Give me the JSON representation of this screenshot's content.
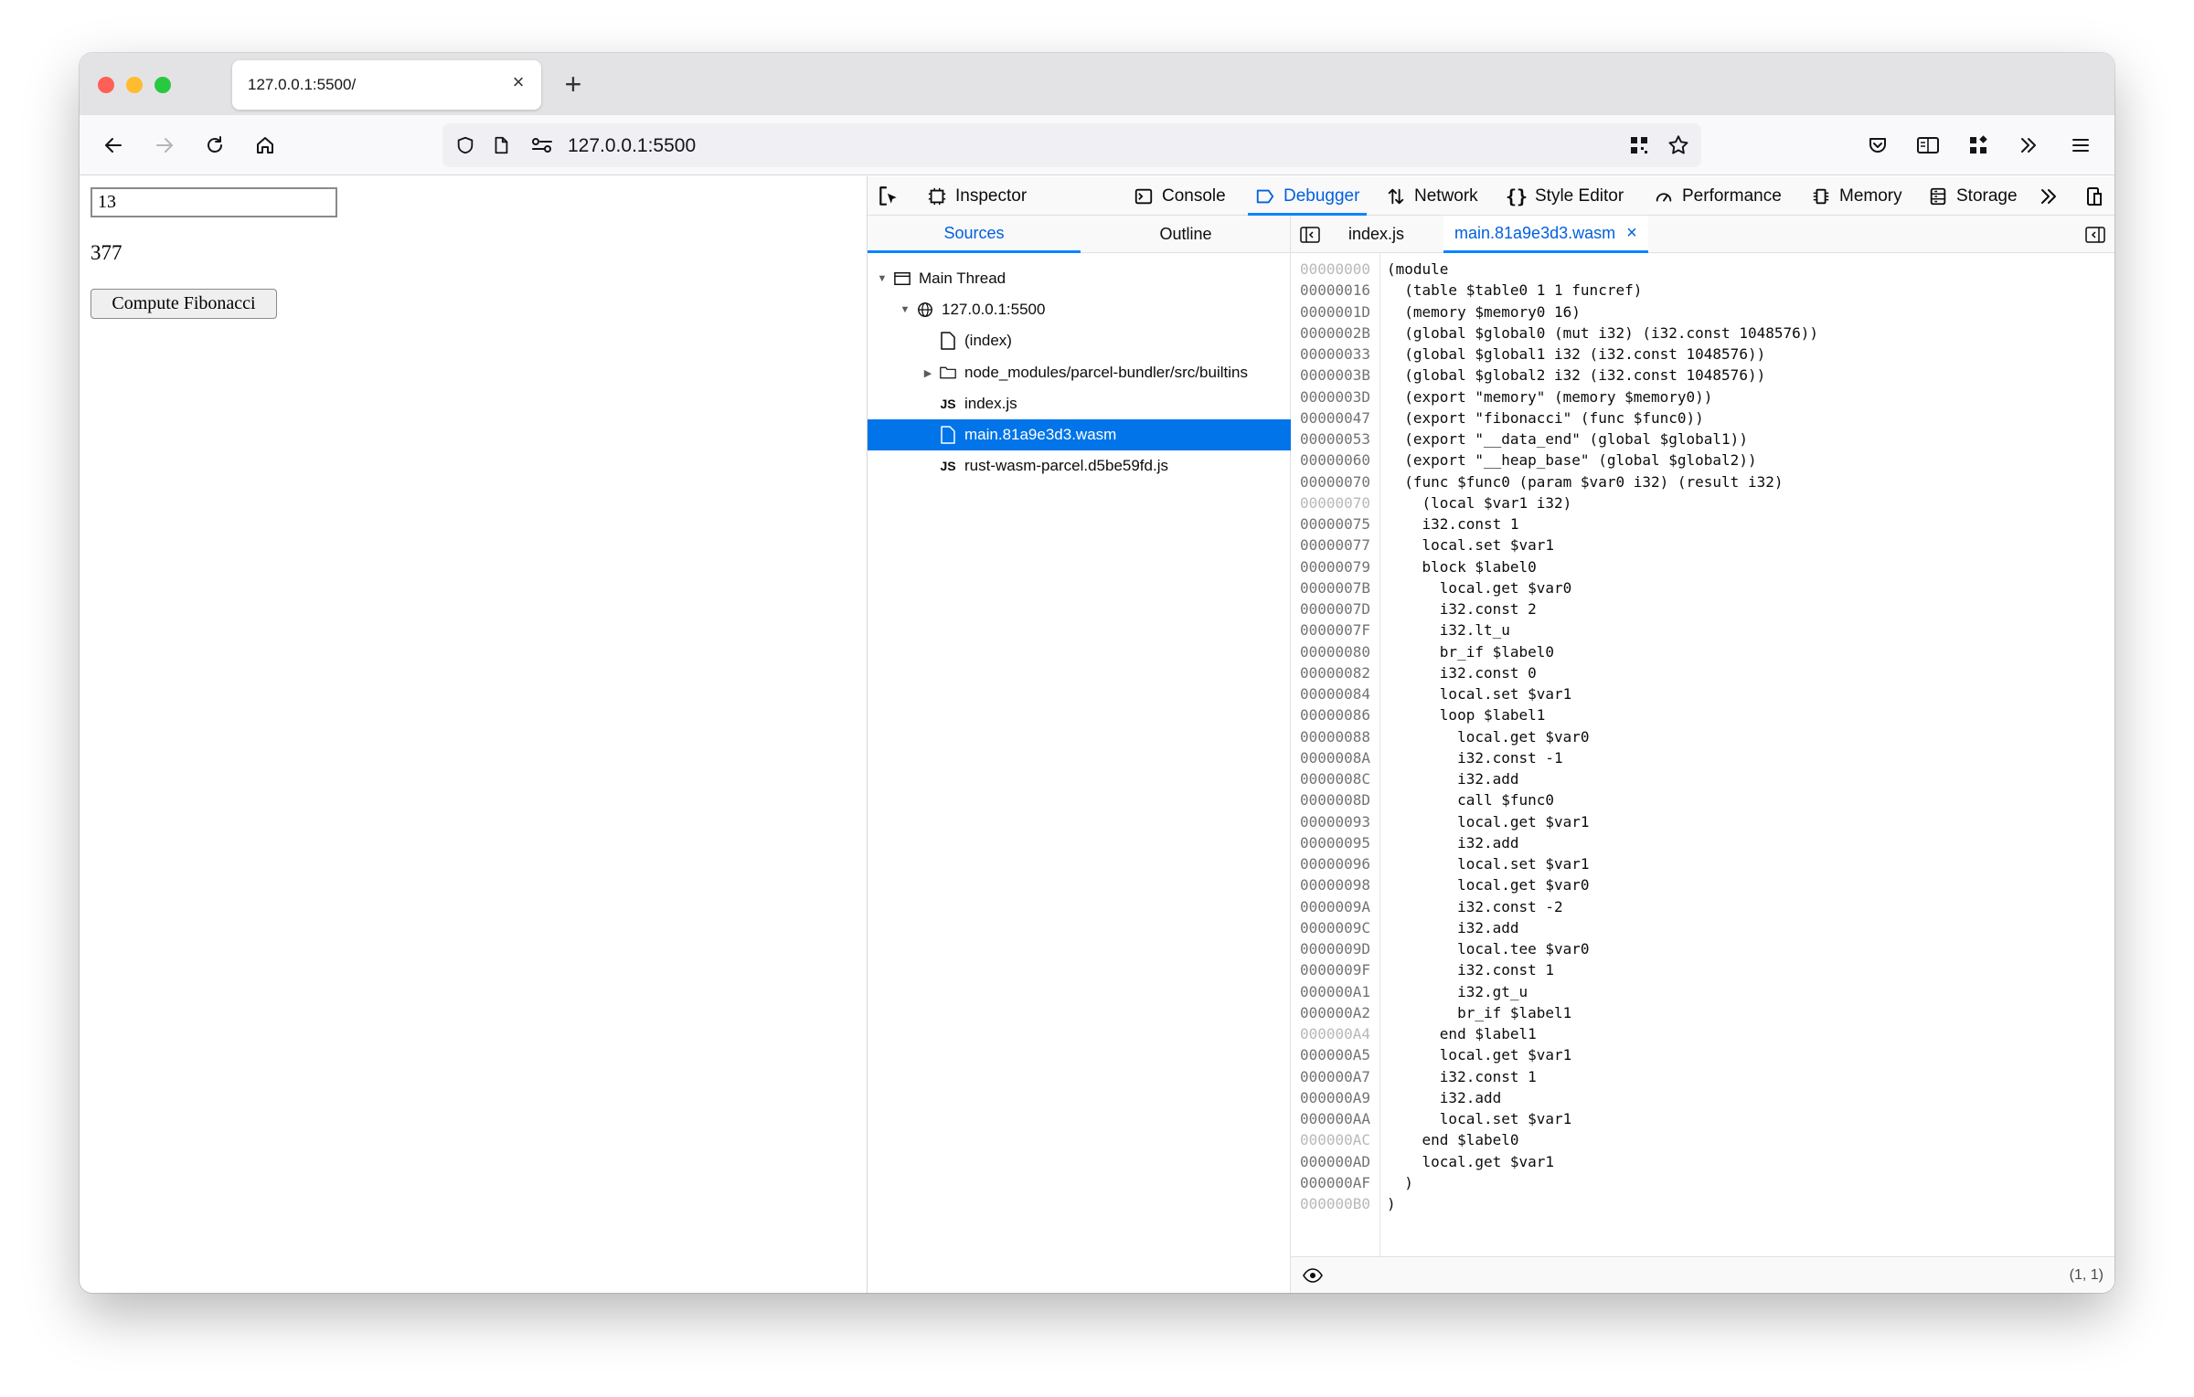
{
  "browser": {
    "tab_title": "127.0.0.1:5500/",
    "url": "127.0.0.1:5500"
  },
  "page": {
    "input_value": "13",
    "result": "377",
    "button_label": "Compute Fibonacci"
  },
  "devtools": {
    "tools": [
      "Inspector",
      "Console",
      "Debugger",
      "Network",
      "Style Editor",
      "Performance",
      "Memory",
      "Storage"
    ],
    "selected_tool": "Debugger",
    "pane_tabs": [
      "Sources",
      "Outline"
    ],
    "tree": [
      {
        "label": "Main Thread"
      },
      {
        "label": "127.0.0.1:5500"
      },
      {
        "label": "(index)"
      },
      {
        "label": "node_modules/parcel-bundler/src/builtins"
      },
      {
        "label": "index.js"
      },
      {
        "label": "main.81a9e3d3.wasm"
      },
      {
        "label": "rust-wasm-parcel.d5be59fd.js"
      }
    ],
    "editor_tabs": [
      "index.js",
      "main.81a9e3d3.wasm"
    ],
    "cursor_position": "(1, 1)",
    "code": [
      {
        "addr": "00000000",
        "text": "(module",
        "dim": true
      },
      {
        "addr": "00000016",
        "text": "  (table $table0 1 1 funcref)",
        "dim": false
      },
      {
        "addr": "0000001D",
        "text": "  (memory $memory0 16)",
        "dim": false
      },
      {
        "addr": "0000002B",
        "text": "  (global $global0 (mut i32) (i32.const 1048576))",
        "dim": false
      },
      {
        "addr": "00000033",
        "text": "  (global $global1 i32 (i32.const 1048576))",
        "dim": false
      },
      {
        "addr": "0000003B",
        "text": "  (global $global2 i32 (i32.const 1048576))",
        "dim": false
      },
      {
        "addr": "0000003D",
        "text": "  (export \"memory\" (memory $memory0))",
        "dim": false
      },
      {
        "addr": "00000047",
        "text": "  (export \"fibonacci\" (func $func0))",
        "dim": false
      },
      {
        "addr": "00000053",
        "text": "  (export \"__data_end\" (global $global1))",
        "dim": false
      },
      {
        "addr": "00000060",
        "text": "  (export \"__heap_base\" (global $global2))",
        "dim": false
      },
      {
        "addr": "00000070",
        "text": "  (func $func0 (param $var0 i32) (result i32)",
        "dim": false
      },
      {
        "addr": "00000070",
        "text": "    (local $var1 i32)",
        "dim": true
      },
      {
        "addr": "00000075",
        "text": "    i32.const 1",
        "dim": false
      },
      {
        "addr": "00000077",
        "text": "    local.set $var1",
        "dim": false
      },
      {
        "addr": "00000079",
        "text": "    block $label0",
        "dim": false
      },
      {
        "addr": "0000007B",
        "text": "      local.get $var0",
        "dim": false
      },
      {
        "addr": "0000007D",
        "text": "      i32.const 2",
        "dim": false
      },
      {
        "addr": "0000007F",
        "text": "      i32.lt_u",
        "dim": false
      },
      {
        "addr": "00000080",
        "text": "      br_if $label0",
        "dim": false
      },
      {
        "addr": "00000082",
        "text": "      i32.const 0",
        "dim": false
      },
      {
        "addr": "00000084",
        "text": "      local.set $var1",
        "dim": false
      },
      {
        "addr": "00000086",
        "text": "      loop $label1",
        "dim": false
      },
      {
        "addr": "00000088",
        "text": "        local.get $var0",
        "dim": false
      },
      {
        "addr": "0000008A",
        "text": "        i32.const -1",
        "dim": false
      },
      {
        "addr": "0000008C",
        "text": "        i32.add",
        "dim": false
      },
      {
        "addr": "0000008D",
        "text": "        call $func0",
        "dim": false
      },
      {
        "addr": "00000093",
        "text": "        local.get $var1",
        "dim": false
      },
      {
        "addr": "00000095",
        "text": "        i32.add",
        "dim": false
      },
      {
        "addr": "00000096",
        "text": "        local.set $var1",
        "dim": false
      },
      {
        "addr": "00000098",
        "text": "        local.get $var0",
        "dim": false
      },
      {
        "addr": "0000009A",
        "text": "        i32.const -2",
        "dim": false
      },
      {
        "addr": "0000009C",
        "text": "        i32.add",
        "dim": false
      },
      {
        "addr": "0000009D",
        "text": "        local.tee $var0",
        "dim": false
      },
      {
        "addr": "0000009F",
        "text": "        i32.const 1",
        "dim": false
      },
      {
        "addr": "000000A1",
        "text": "        i32.gt_u",
        "dim": false
      },
      {
        "addr": "000000A2",
        "text": "        br_if $label1",
        "dim": false
      },
      {
        "addr": "000000A4",
        "text": "      end $label1",
        "dim": true
      },
      {
        "addr": "000000A5",
        "text": "      local.get $var1",
        "dim": false
      },
      {
        "addr": "000000A7",
        "text": "      i32.const 1",
        "dim": false
      },
      {
        "addr": "000000A9",
        "text": "      i32.add",
        "dim": false
      },
      {
        "addr": "000000AA",
        "text": "      local.set $var1",
        "dim": false
      },
      {
        "addr": "000000AC",
        "text": "    end $label0",
        "dim": true
      },
      {
        "addr": "000000AD",
        "text": "    local.get $var1",
        "dim": false
      },
      {
        "addr": "000000AF",
        "text": "  )",
        "dim": false
      },
      {
        "addr": "000000B0",
        "text": ")",
        "dim": true
      }
    ]
  },
  "colors": {
    "accent": "#0a84ff",
    "selection": "#0074e8",
    "traffic_red": "#ff5f57",
    "traffic_yellow": "#febc2e",
    "traffic_green": "#28c840"
  }
}
